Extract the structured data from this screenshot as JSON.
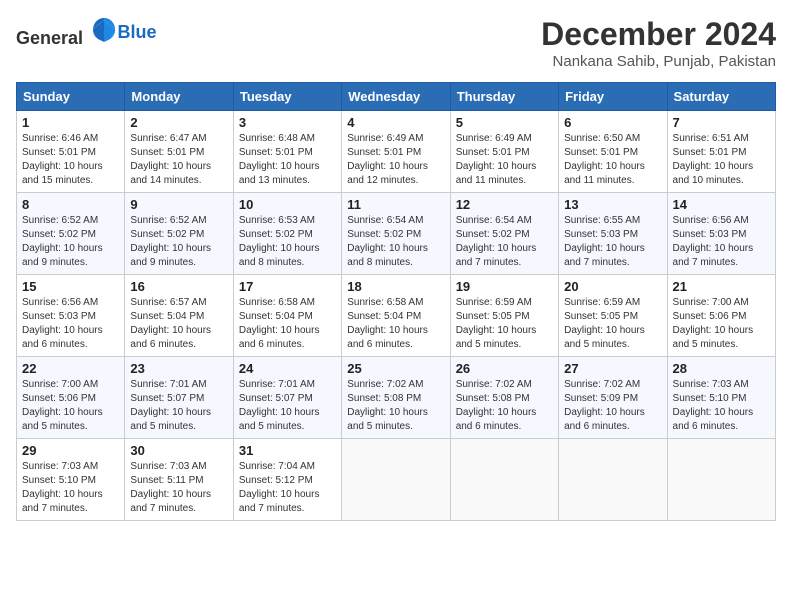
{
  "logo": {
    "general": "General",
    "blue": "Blue"
  },
  "title": {
    "month": "December 2024",
    "location": "Nankana Sahib, Punjab, Pakistan"
  },
  "headers": [
    "Sunday",
    "Monday",
    "Tuesday",
    "Wednesday",
    "Thursday",
    "Friday",
    "Saturday"
  ],
  "weeks": [
    [
      {
        "day": "1",
        "sunrise": "6:46 AM",
        "sunset": "5:01 PM",
        "daylight": "10 hours and 15 minutes."
      },
      {
        "day": "2",
        "sunrise": "6:47 AM",
        "sunset": "5:01 PM",
        "daylight": "10 hours and 14 minutes."
      },
      {
        "day": "3",
        "sunrise": "6:48 AM",
        "sunset": "5:01 PM",
        "daylight": "10 hours and 13 minutes."
      },
      {
        "day": "4",
        "sunrise": "6:49 AM",
        "sunset": "5:01 PM",
        "daylight": "10 hours and 12 minutes."
      },
      {
        "day": "5",
        "sunrise": "6:49 AM",
        "sunset": "5:01 PM",
        "daylight": "10 hours and 11 minutes."
      },
      {
        "day": "6",
        "sunrise": "6:50 AM",
        "sunset": "5:01 PM",
        "daylight": "10 hours and 11 minutes."
      },
      {
        "day": "7",
        "sunrise": "6:51 AM",
        "sunset": "5:01 PM",
        "daylight": "10 hours and 10 minutes."
      }
    ],
    [
      {
        "day": "8",
        "sunrise": "6:52 AM",
        "sunset": "5:02 PM",
        "daylight": "10 hours and 9 minutes."
      },
      {
        "day": "9",
        "sunrise": "6:52 AM",
        "sunset": "5:02 PM",
        "daylight": "10 hours and 9 minutes."
      },
      {
        "day": "10",
        "sunrise": "6:53 AM",
        "sunset": "5:02 PM",
        "daylight": "10 hours and 8 minutes."
      },
      {
        "day": "11",
        "sunrise": "6:54 AM",
        "sunset": "5:02 PM",
        "daylight": "10 hours and 8 minutes."
      },
      {
        "day": "12",
        "sunrise": "6:54 AM",
        "sunset": "5:02 PM",
        "daylight": "10 hours and 7 minutes."
      },
      {
        "day": "13",
        "sunrise": "6:55 AM",
        "sunset": "5:03 PM",
        "daylight": "10 hours and 7 minutes."
      },
      {
        "day": "14",
        "sunrise": "6:56 AM",
        "sunset": "5:03 PM",
        "daylight": "10 hours and 7 minutes."
      }
    ],
    [
      {
        "day": "15",
        "sunrise": "6:56 AM",
        "sunset": "5:03 PM",
        "daylight": "10 hours and 6 minutes."
      },
      {
        "day": "16",
        "sunrise": "6:57 AM",
        "sunset": "5:04 PM",
        "daylight": "10 hours and 6 minutes."
      },
      {
        "day": "17",
        "sunrise": "6:58 AM",
        "sunset": "5:04 PM",
        "daylight": "10 hours and 6 minutes."
      },
      {
        "day": "18",
        "sunrise": "6:58 AM",
        "sunset": "5:04 PM",
        "daylight": "10 hours and 6 minutes."
      },
      {
        "day": "19",
        "sunrise": "6:59 AM",
        "sunset": "5:05 PM",
        "daylight": "10 hours and 5 minutes."
      },
      {
        "day": "20",
        "sunrise": "6:59 AM",
        "sunset": "5:05 PM",
        "daylight": "10 hours and 5 minutes."
      },
      {
        "day": "21",
        "sunrise": "7:00 AM",
        "sunset": "5:06 PM",
        "daylight": "10 hours and 5 minutes."
      }
    ],
    [
      {
        "day": "22",
        "sunrise": "7:00 AM",
        "sunset": "5:06 PM",
        "daylight": "10 hours and 5 minutes."
      },
      {
        "day": "23",
        "sunrise": "7:01 AM",
        "sunset": "5:07 PM",
        "daylight": "10 hours and 5 minutes."
      },
      {
        "day": "24",
        "sunrise": "7:01 AM",
        "sunset": "5:07 PM",
        "daylight": "10 hours and 5 minutes."
      },
      {
        "day": "25",
        "sunrise": "7:02 AM",
        "sunset": "5:08 PM",
        "daylight": "10 hours and 5 minutes."
      },
      {
        "day": "26",
        "sunrise": "7:02 AM",
        "sunset": "5:08 PM",
        "daylight": "10 hours and 6 minutes."
      },
      {
        "day": "27",
        "sunrise": "7:02 AM",
        "sunset": "5:09 PM",
        "daylight": "10 hours and 6 minutes."
      },
      {
        "day": "28",
        "sunrise": "7:03 AM",
        "sunset": "5:10 PM",
        "daylight": "10 hours and 6 minutes."
      }
    ],
    [
      {
        "day": "29",
        "sunrise": "7:03 AM",
        "sunset": "5:10 PM",
        "daylight": "10 hours and 7 minutes."
      },
      {
        "day": "30",
        "sunrise": "7:03 AM",
        "sunset": "5:11 PM",
        "daylight": "10 hours and 7 minutes."
      },
      {
        "day": "31",
        "sunrise": "7:04 AM",
        "sunset": "5:12 PM",
        "daylight": "10 hours and 7 minutes."
      },
      null,
      null,
      null,
      null
    ]
  ]
}
